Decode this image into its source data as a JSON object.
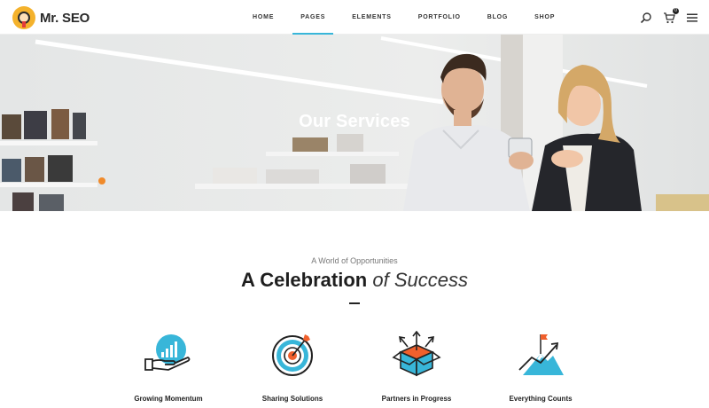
{
  "brand": {
    "name": "Mr. SEO"
  },
  "nav": {
    "items": [
      {
        "label": "HOME",
        "active": false
      },
      {
        "label": "PAGES",
        "active": true
      },
      {
        "label": "ELEMENTS",
        "active": false
      },
      {
        "label": "PORTFOLIO",
        "active": false
      },
      {
        "label": "BLOG",
        "active": false
      },
      {
        "label": "SHOP",
        "active": false
      }
    ]
  },
  "tools": {
    "search_icon": "search-icon",
    "cart_icon": "cart-icon",
    "cart_count": "0",
    "menu_icon": "hamburger-menu-icon"
  },
  "hero": {
    "title": "Our Services"
  },
  "section": {
    "kicker": "A World of Opportunities",
    "headline_bold": "A Celebration",
    "headline_light": "of Success"
  },
  "features": [
    {
      "label": "Growing Momentum",
      "icon": "hand-chart-icon"
    },
    {
      "label": "Sharing Solutions",
      "icon": "target-icon"
    },
    {
      "label": "Partners in Progress",
      "icon": "box-arrows-icon"
    },
    {
      "label": "Everything Counts",
      "icon": "mountain-flag-icon"
    }
  ],
  "colors": {
    "accent": "#38b6d9",
    "orange": "#f0602d",
    "dark": "#222222"
  }
}
